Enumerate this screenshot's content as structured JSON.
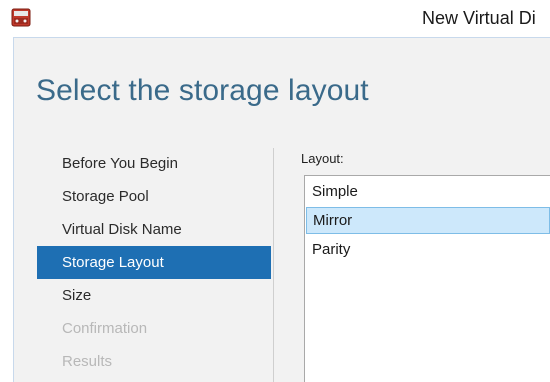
{
  "window": {
    "title": "New Virtual Di",
    "icon": "virtual-disk-wizard-icon"
  },
  "page": {
    "heading": "Select the storage layout"
  },
  "nav": {
    "items": [
      {
        "label": "Before You Begin",
        "state": "normal"
      },
      {
        "label": "Storage Pool",
        "state": "normal"
      },
      {
        "label": "Virtual Disk Name",
        "state": "normal"
      },
      {
        "label": "Storage Layout",
        "state": "selected"
      },
      {
        "label": "Size",
        "state": "normal"
      },
      {
        "label": "Confirmation",
        "state": "disabled"
      },
      {
        "label": "Results",
        "state": "disabled"
      }
    ]
  },
  "layout": {
    "label": "Layout:",
    "options": [
      "Simple",
      "Mirror",
      "Parity"
    ],
    "selected": "Mirror"
  },
  "colors": {
    "accent": "#1e6fb3",
    "heading": "#3a6a8a",
    "selection_bg": "#cde8fb",
    "selection_border": "#7ebde7",
    "panel_bg": "#f2f2f2"
  }
}
